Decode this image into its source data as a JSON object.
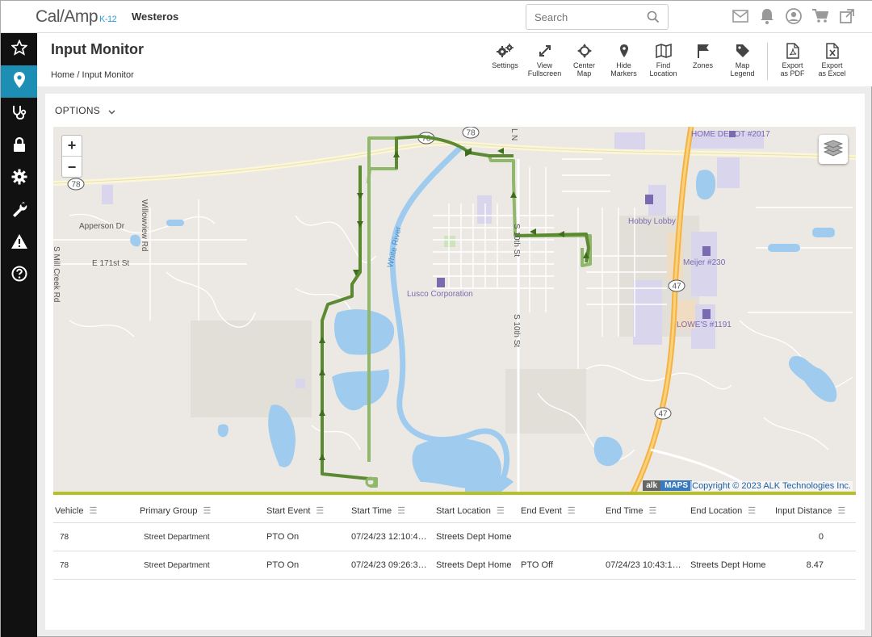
{
  "brand": {
    "name": "Cal/Amp",
    "sub": "K-12"
  },
  "tenant": "Westeros",
  "search": {
    "placeholder": "Search"
  },
  "page": {
    "title": "Input Monitor",
    "breadcrumb_home": "Home",
    "breadcrumb_sep": "/",
    "breadcrumb_current": "Input Monitor"
  },
  "toolbar": {
    "settings": "Settings",
    "fullscreen_1": "View",
    "fullscreen_2": "Fullscreen",
    "center_1": "Center",
    "center_2": "Map",
    "hide_1": "Hide",
    "hide_2": "Markers",
    "find_1": "Find",
    "find_2": "Location",
    "zones": "Zones",
    "legend_1": "Map",
    "legend_2": "Legend",
    "pdf_1": "Export",
    "pdf_2": "as PDF",
    "excel_1": "Export",
    "excel_2": "as Excel"
  },
  "options_label": "OPTIONS",
  "map": {
    "zoom_in": "+",
    "zoom_out": "−",
    "copyright": "Copyright © 2023 ALK Technologies Inc.",
    "alk": "alk",
    "maps": "MAPS",
    "labels": {
      "home_depot": "HOME DEPOT #2017",
      "hobby_lobby": "Hobby Lobby",
      "meijer": "Meijer #230",
      "lowes": "LOWE'S #1191",
      "lusco": "Lusco Corporation",
      "apperson": "Apperson Dr",
      "willowview": "Willowview Rd",
      "e171": "E 171st St",
      "white_river": "White River",
      "s10th_a": "S 10th St",
      "s10th_b": "S 10th St",
      "mill_creek": "S Mill Creek Rd",
      "ln": "L N",
      "rt78a": "78",
      "rt78b": "78",
      "rt78c": "78",
      "rt47a": "47",
      "rt47b": "47"
    }
  },
  "table": {
    "columns": [
      "Vehicle",
      "Primary Group",
      "Start Event",
      "Start Time",
      "Start Location",
      "End Event",
      "End Time",
      "End Location",
      "Input Distance"
    ],
    "rows": [
      [
        "78",
        "Street Department",
        "PTO On",
        "07/24/23 12:10:4…",
        "Streets Dept Home",
        "",
        "",
        "",
        "0"
      ],
      [
        "78",
        "Street Department",
        "PTO On",
        "07/24/23 09:26:3…",
        "Streets Dept Home",
        "PTO Off",
        "07/24/23 10:43:1…",
        "Streets Dept Home",
        "8.47"
      ]
    ]
  },
  "colors": {
    "accent": "#1d8fb5",
    "route": "#4f8a2b",
    "route_light": "#8fb86a",
    "water": "#9ecbee"
  }
}
